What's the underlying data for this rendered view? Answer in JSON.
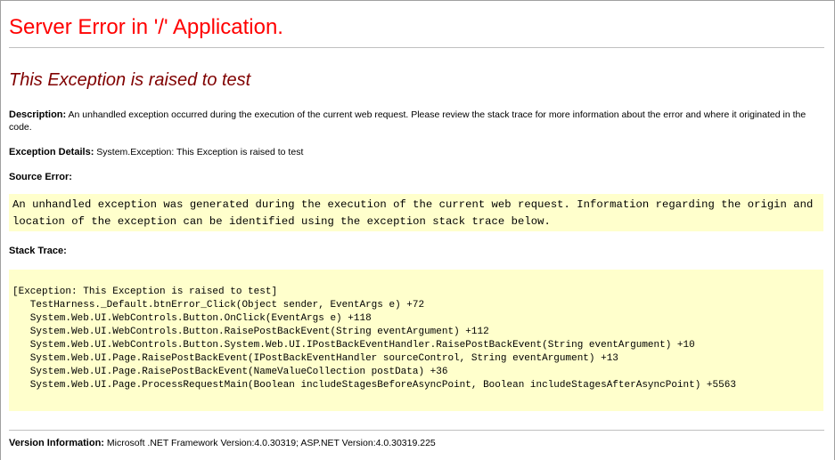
{
  "title": "Server Error in '/' Application.",
  "exception_title": "This Exception is raised to test",
  "description": {
    "label": "Description:",
    "text": "An unhandled exception occurred during the execution of the current web request. Please review the stack trace for more information about the error and where it originated in the code."
  },
  "exception_details": {
    "label": "Exception Details:",
    "text": "System.Exception: This Exception is raised to test"
  },
  "source_error": {
    "label": "Source Error:",
    "text": "An unhandled exception was generated during the execution of the current web request. Information regarding the origin and location of the exception can be identified using the exception stack trace below."
  },
  "stack_trace": {
    "label": "Stack Trace:",
    "lines": [
      "[Exception: This Exception is raised to test]",
      "   TestHarness._Default.btnError_Click(Object sender, EventArgs e) +72",
      "   System.Web.UI.WebControls.Button.OnClick(EventArgs e) +118",
      "   System.Web.UI.WebControls.Button.RaisePostBackEvent(String eventArgument) +112",
      "   System.Web.UI.WebControls.Button.System.Web.UI.IPostBackEventHandler.RaisePostBackEvent(String eventArgument) +10",
      "   System.Web.UI.Page.RaisePostBackEvent(IPostBackEventHandler sourceControl, String eventArgument) +13",
      "   System.Web.UI.Page.RaisePostBackEvent(NameValueCollection postData) +36",
      "   System.Web.UI.Page.ProcessRequestMain(Boolean includeStagesBeforeAsyncPoint, Boolean includeStagesAfterAsyncPoint) +5563"
    ]
  },
  "version_info": {
    "label": "Version Information:",
    "text": "Microsoft .NET Framework Version:4.0.30319; ASP.NET Version:4.0.30319.225"
  },
  "colors": {
    "title": "#ff0000",
    "exception_title": "#800000",
    "code_background": "#ffffcc",
    "rule": "#c0c0c0"
  }
}
